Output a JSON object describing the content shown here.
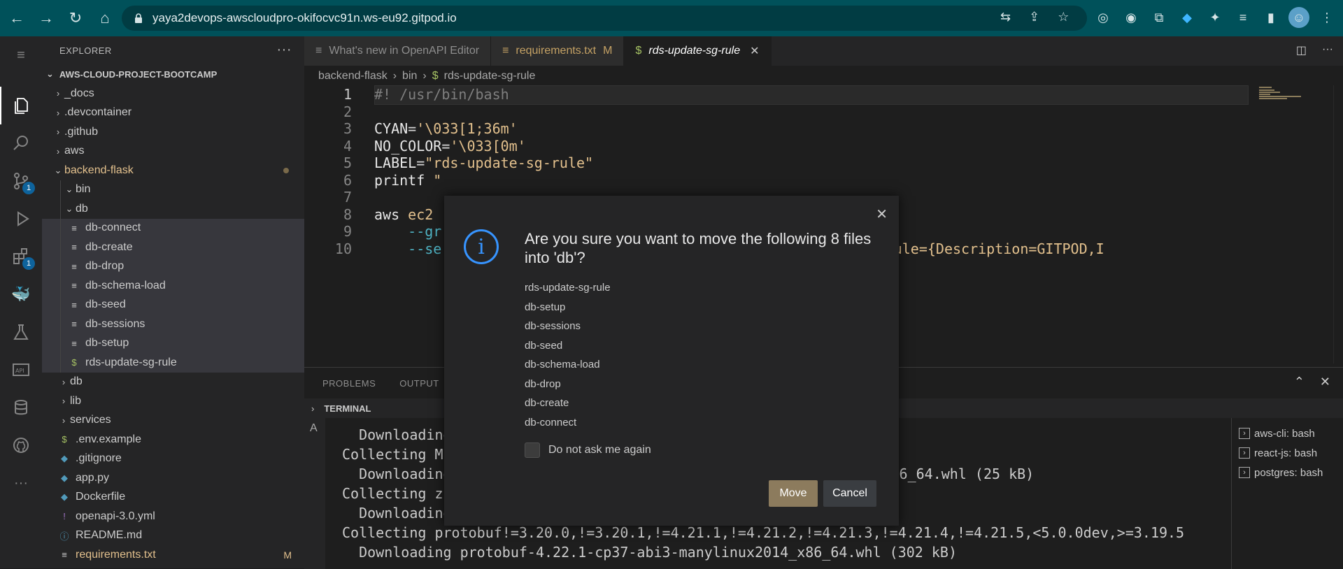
{
  "browser": {
    "url": "yaya2devops-awscloudpro-okifocvc91n.ws-eu92.gitpod.io"
  },
  "activity": {
    "scm_badge": "1",
    "extensions_badge": "1"
  },
  "explorer": {
    "title": "EXPLORER",
    "project": "AWS-CLOUD-PROJECT-BOOTCAMP",
    "items": [
      {
        "label": "_docs",
        "twisty": "›",
        "icon": "",
        "modified": ""
      },
      {
        "label": ".devcontainer",
        "twisty": "›",
        "icon": "",
        "modified": ""
      },
      {
        "label": ".github",
        "twisty": "›",
        "icon": "",
        "modified": ""
      },
      {
        "label": "aws",
        "twisty": "›",
        "icon": "",
        "modified": ""
      },
      {
        "label": "backend-flask",
        "twisty": "⌄",
        "icon": "",
        "modified": ""
      },
      {
        "label": "bin",
        "twisty": "⌄",
        "icon": "",
        "modified": ""
      },
      {
        "label": "db",
        "twisty": "⌄",
        "icon": "",
        "modified": ""
      },
      {
        "label": "db-connect",
        "twisty": "",
        "icon": "≡",
        "modified": ""
      },
      {
        "label": "db-create",
        "twisty": "",
        "icon": "≡",
        "modified": ""
      },
      {
        "label": "db-drop",
        "twisty": "",
        "icon": "≡",
        "modified": ""
      },
      {
        "label": "db-schema-load",
        "twisty": "",
        "icon": "≡",
        "modified": ""
      },
      {
        "label": "db-seed",
        "twisty": "",
        "icon": "≡",
        "modified": ""
      },
      {
        "label": "db-sessions",
        "twisty": "",
        "icon": "≡",
        "modified": ""
      },
      {
        "label": "db-setup",
        "twisty": "",
        "icon": "≡",
        "modified": ""
      },
      {
        "label": "rds-update-sg-rule",
        "twisty": "",
        "icon": "$",
        "modified": ""
      },
      {
        "label": "db",
        "twisty": "›",
        "icon": "",
        "modified": ""
      },
      {
        "label": "lib",
        "twisty": "›",
        "icon": "",
        "modified": ""
      },
      {
        "label": "services",
        "twisty": "›",
        "icon": "",
        "modified": ""
      },
      {
        "label": ".env.example",
        "twisty": "",
        "icon": "$",
        "modified": ""
      },
      {
        "label": ".gitignore",
        "twisty": "",
        "icon": "◆",
        "modified": ""
      },
      {
        "label": "app.py",
        "twisty": "",
        "icon": "◆",
        "modified": ""
      },
      {
        "label": "Dockerfile",
        "twisty": "",
        "icon": "◆",
        "modified": ""
      },
      {
        "label": "openapi-3.0.yml",
        "twisty": "",
        "icon": "!",
        "modified": ""
      },
      {
        "label": "README.md",
        "twisty": "",
        "icon": "ⓘ",
        "modified": ""
      },
      {
        "label": "requirements.txt",
        "twisty": "",
        "icon": "≡",
        "modified": "M"
      }
    ]
  },
  "tabs": [
    {
      "label": "What's new in OpenAPI Editor",
      "icon": "≡",
      "modified": ""
    },
    {
      "label": "requirements.txt",
      "icon": "≡",
      "modified": "M"
    },
    {
      "label": "rds-update-sg-rule",
      "icon": "$",
      "modified": ""
    }
  ],
  "breadcrumb": [
    "backend-flask",
    "bin",
    "rds-update-sg-rule"
  ],
  "editor": {
    "lines": [
      {
        "n": "1",
        "text": "#! /usr/bin/bash"
      },
      {
        "n": "2",
        "text": ""
      },
      {
        "n": "3",
        "text": "CYAN='\\033[1;36m'"
      },
      {
        "n": "4",
        "text": "NO_COLOR='\\033[0m'"
      },
      {
        "n": "5",
        "text": "LABEL=\"rds-update-sg-rule\""
      },
      {
        "n": "6",
        "text": "printf \""
      },
      {
        "n": "7",
        "text": ""
      },
      {
        "n": "8",
        "text": "aws ec2"
      },
      {
        "n": "9",
        "text": "    --gr"
      },
      {
        "n": "10",
        "text": "    --se"
      }
    ],
    "line10_tail": "ID,SecurityGroupRule={Description=GITPOD,I"
  },
  "panel": {
    "tabs": [
      "PROBLEMS",
      "OUTPUT"
    ],
    "terminal_label": "TERMINAL",
    "terminal_lines": [
      "  Downloading",
      "Collecting M",
      "  Downloading",
      "Collecting z",
      "  Downloading",
      "Collecting protobuf!=3.20.0,!=3.20.1,!=4.21.1,!=4.21.2,!=4.21.3,!=4.21.4,!=4.21.5,<5.0.0dev,>=3.19.5",
      "  Downloading protobuf-4.22.1-cp37-abi3-manylinux2014_x86_64.whl (302 kB)"
    ],
    "terminal_line3_tail": "ylinux2014_x86_64.whl (25 kB)",
    "terminals": [
      "aws-cli: bash",
      "react-js: bash",
      "postgres: bash"
    ]
  },
  "modal": {
    "title": "Are you sure you want to move the following 8 files into 'db'?",
    "files": [
      "rds-update-sg-rule",
      "db-setup",
      "db-sessions",
      "db-seed",
      "db-schema-load",
      "db-drop",
      "db-create",
      "db-connect"
    ],
    "checkbox_label": "Do not ask me again",
    "move_label": "Move",
    "cancel_label": "Cancel"
  }
}
